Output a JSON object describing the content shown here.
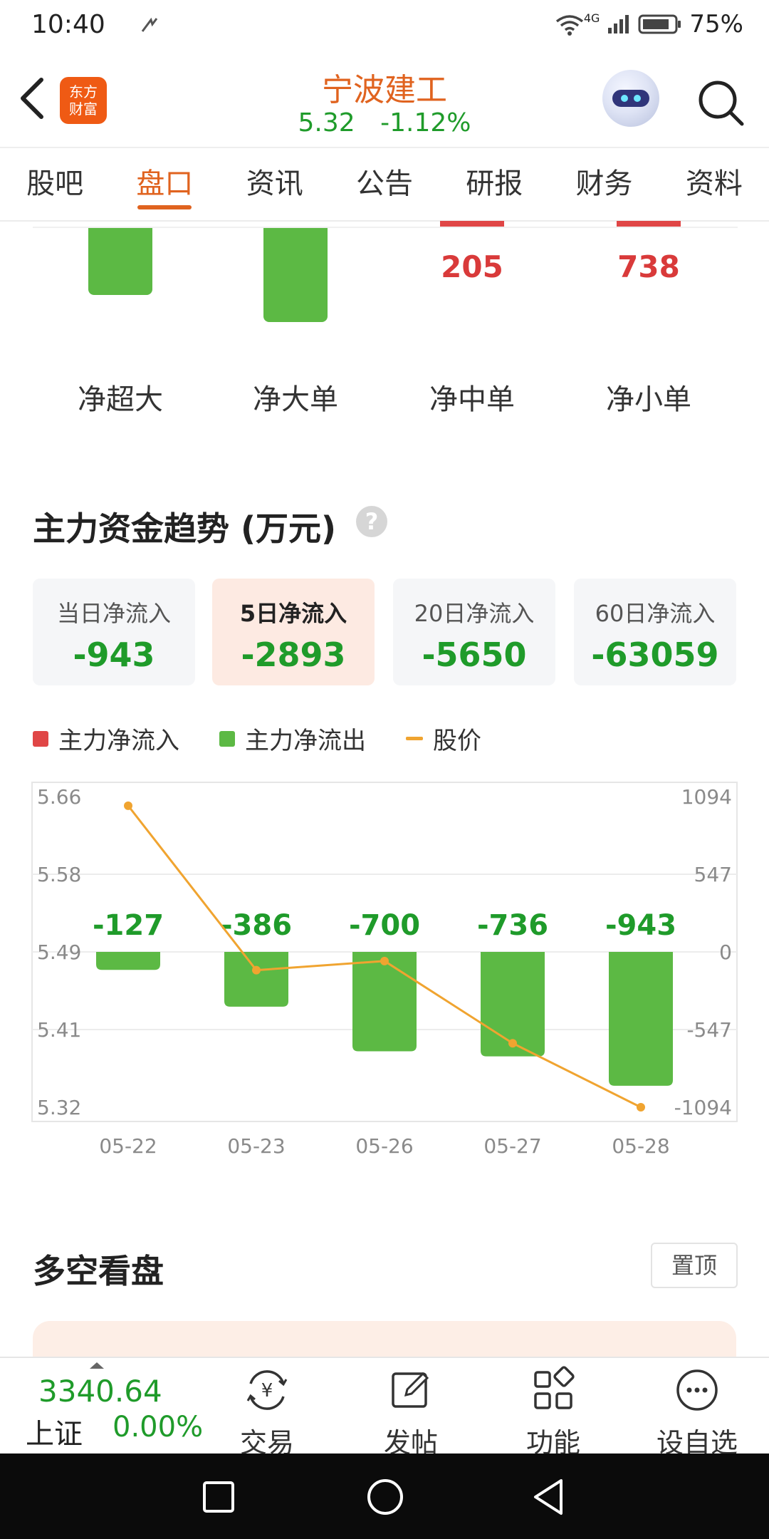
{
  "status_bar": {
    "time": "10:40",
    "network": "4G",
    "battery": "75%"
  },
  "header": {
    "logo_text_line1": "东方",
    "logo_text_line2": "财富",
    "title": "宁波建工",
    "price": "5.32",
    "change": "-1.12%"
  },
  "tabs": [
    {
      "label": "股吧",
      "active": false
    },
    {
      "label": "盘口",
      "active": true
    },
    {
      "label": "资讯",
      "active": false
    },
    {
      "label": "公告",
      "active": false
    },
    {
      "label": "研报",
      "active": false
    },
    {
      "label": "财务",
      "active": false
    },
    {
      "label": "资料",
      "active": false
    }
  ],
  "flow_breakdown": {
    "items": [
      {
        "label": "净超大",
        "value": "",
        "direction": "out"
      },
      {
        "label": "净大单",
        "value": "",
        "direction": "out"
      },
      {
        "label": "净中单",
        "value": "205",
        "direction": "in"
      },
      {
        "label": "净小单",
        "value": "738",
        "direction": "in"
      }
    ]
  },
  "trend": {
    "title": "主力资金趋势 (万元)",
    "help": "?",
    "cards": [
      {
        "label": "当日净流入",
        "value": "-943",
        "active": false
      },
      {
        "label": "5日净流入",
        "value": "-2893",
        "active": true
      },
      {
        "label": "20日净流入",
        "value": "-5650",
        "active": false
      },
      {
        "label": "60日净流入",
        "value": "-63059",
        "active": false
      }
    ],
    "legend": {
      "inflow": "主力净流入",
      "outflow": "主力净流出",
      "price": "股价"
    }
  },
  "chart_data": {
    "type": "bar",
    "categories": [
      "05-22",
      "05-23",
      "05-26",
      "05-27",
      "05-28"
    ],
    "series": [
      {
        "name": "主力净流出",
        "values": [
          -127,
          -386,
          -700,
          -736,
          -943
        ],
        "color": "#5cb944"
      },
      {
        "name": "股价",
        "type": "line",
        "values": [
          5.65,
          5.47,
          5.48,
          5.39,
          5.32
        ],
        "color": "#f0a430"
      }
    ],
    "value_labels": [
      "-127",
      "-386",
      "-700",
      "-736",
      "-943"
    ],
    "y_left_ticks": [
      "5.66",
      "5.58",
      "5.49",
      "5.41",
      "5.32"
    ],
    "y_right_ticks": [
      "1094",
      "547",
      "0",
      "-547",
      "-1094"
    ],
    "ylim_left": [
      5.32,
      5.66
    ],
    "ylim_right": [
      -1094,
      1094
    ]
  },
  "section2": {
    "title": "多空看盘",
    "pin_label": "置顶"
  },
  "bottom_bar": {
    "index_value": "3340.64",
    "index_name": "上证",
    "index_change": "0.00%",
    "nav": [
      {
        "label": "交易",
        "icon": "trade-icon"
      },
      {
        "label": "发帖",
        "icon": "post-icon"
      },
      {
        "label": "功能",
        "icon": "grid-icon"
      },
      {
        "label": "设自选",
        "icon": "more-icon"
      }
    ]
  },
  "colors": {
    "accent": "#e0631f",
    "green": "#1f9b2a",
    "bar_green": "#5cb944",
    "red": "#e04646",
    "price_line": "#f0a430"
  }
}
